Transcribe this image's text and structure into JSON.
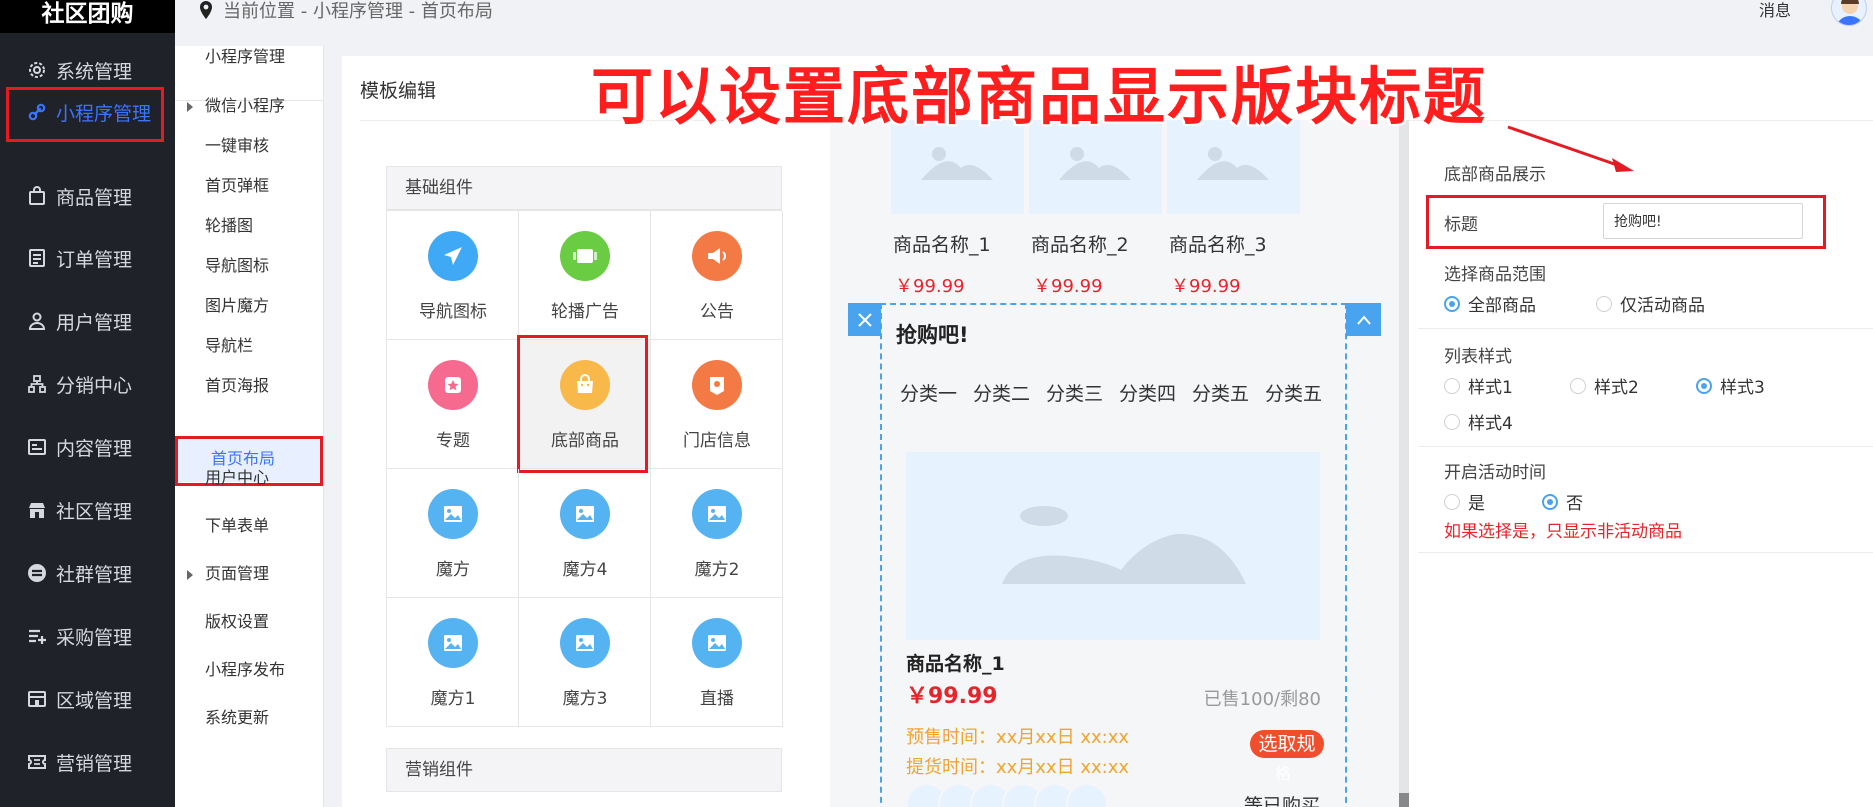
{
  "brand": "社区团购",
  "sidebar": {
    "items": [
      {
        "label": "系统管理",
        "icon": "gear-icon"
      },
      {
        "label": "小程序管理",
        "icon": "link-icon",
        "active": true
      },
      {
        "label": "商品管理",
        "icon": "bag-icon"
      },
      {
        "label": "订单管理",
        "icon": "list-icon"
      },
      {
        "label": "用户管理",
        "icon": "user-icon"
      },
      {
        "label": "分销中心",
        "icon": "tree-icon"
      },
      {
        "label": "内容管理",
        "icon": "document-icon"
      },
      {
        "label": "社区管理",
        "icon": "store-icon"
      },
      {
        "label": "社群管理",
        "icon": "equal-circle-icon"
      },
      {
        "label": "采购管理",
        "icon": "list-add-icon"
      },
      {
        "label": "区域管理",
        "icon": "shop-icon"
      },
      {
        "label": "营销管理",
        "icon": "ticket-icon"
      }
    ]
  },
  "subnav": {
    "items": [
      {
        "label": "小程序管理"
      },
      {
        "label": "微信小程序",
        "expand": true
      },
      {
        "label": "一键审核"
      },
      {
        "label": "首页弹框"
      },
      {
        "label": "轮播图"
      },
      {
        "label": "导航图标"
      },
      {
        "label": "图片魔方"
      },
      {
        "label": "导航栏"
      },
      {
        "label": "首页海报"
      },
      {
        "label": "首页布局",
        "active": true
      },
      {
        "label": "用户中心"
      },
      {
        "label": "下单表单"
      },
      {
        "label": "页面管理",
        "expand": true
      },
      {
        "label": "版权设置"
      },
      {
        "label": "小程序发布"
      },
      {
        "label": "系统更新"
      }
    ]
  },
  "topbar": {
    "breadcrumb": "当前位置 - 小程序管理 - 首页布局",
    "messages": "消息"
  },
  "panel": {
    "title": "模板编辑"
  },
  "annotation": "可以设置底部商品显示版块标题",
  "palette": {
    "basic_title": "基础组件",
    "marketing_title": "营销组件",
    "components": [
      {
        "label": "导航图标",
        "icon": "paper-plane-icon",
        "color": "#3fa9f5"
      },
      {
        "label": "轮播广告",
        "icon": "carousel-icon",
        "color": "#69cc43"
      },
      {
        "label": "公告",
        "icon": "megaphone-icon",
        "color": "#f47a45"
      },
      {
        "label": "专题",
        "icon": "star-badge-icon",
        "color": "#f56a8e"
      },
      {
        "label": "底部商品",
        "icon": "shopping-bag-icon",
        "color": "#f8b84a",
        "selected": true
      },
      {
        "label": "门店信息",
        "icon": "location-icon",
        "color": "#f47a45"
      },
      {
        "label": "魔方",
        "icon": "image-icon",
        "color": "#56b3f1"
      },
      {
        "label": "魔方4",
        "icon": "image-icon",
        "color": "#56b3f1"
      },
      {
        "label": "魔方2",
        "icon": "image-icon",
        "color": "#56b3f1"
      },
      {
        "label": "魔方1",
        "icon": "image-icon",
        "color": "#56b3f1"
      },
      {
        "label": "魔方3",
        "icon": "image-icon",
        "color": "#56b3f1"
      },
      {
        "label": "直播",
        "icon": "image-icon",
        "color": "#56b3f1"
      }
    ]
  },
  "preview": {
    "products": [
      {
        "name": "商品名称_1",
        "price": "￥99.99"
      },
      {
        "name": "商品名称_2",
        "price": "￥99.99"
      },
      {
        "name": "商品名称_3",
        "price": "￥99.99"
      }
    ],
    "block_title": "抢购吧!",
    "categories": [
      "分类一",
      "分类二",
      "分类三",
      "分类四",
      "分类五",
      "分类五"
    ],
    "big_product": {
      "name": "商品名称_1",
      "price": "￥99.99",
      "sold": "已售100/剩80",
      "presale": "预售时间：xx月xx日 xx:xx",
      "pickup": "提货时间：xx月xx日 xx:xx",
      "button": "选取规",
      "button_line2": "格",
      "buyers": "等已购买"
    }
  },
  "settings": {
    "section_title": "底部商品展示",
    "title_label": "标题",
    "title_value": "抢购吧!",
    "range_label": "选择商品范围",
    "range_options": [
      {
        "label": "全部商品",
        "checked": true
      },
      {
        "label": "仅活动商品",
        "checked": false
      }
    ],
    "style_label": "列表样式",
    "style_options": [
      {
        "label": "样式1",
        "checked": false
      },
      {
        "label": "样式2",
        "checked": false
      },
      {
        "label": "样式3",
        "checked": true
      },
      {
        "label": "样式4",
        "checked": false
      }
    ],
    "time_label": "开启活动时间",
    "time_options": [
      {
        "label": "是",
        "checked": false
      },
      {
        "label": "否",
        "checked": true
      }
    ],
    "hint": "如果选择是，只显示非活动商品"
  },
  "colors": {
    "accent": "#3b74ff",
    "highlight": "#e41b23",
    "price": "#e4262b",
    "preview_border": "#4aa3ee"
  }
}
